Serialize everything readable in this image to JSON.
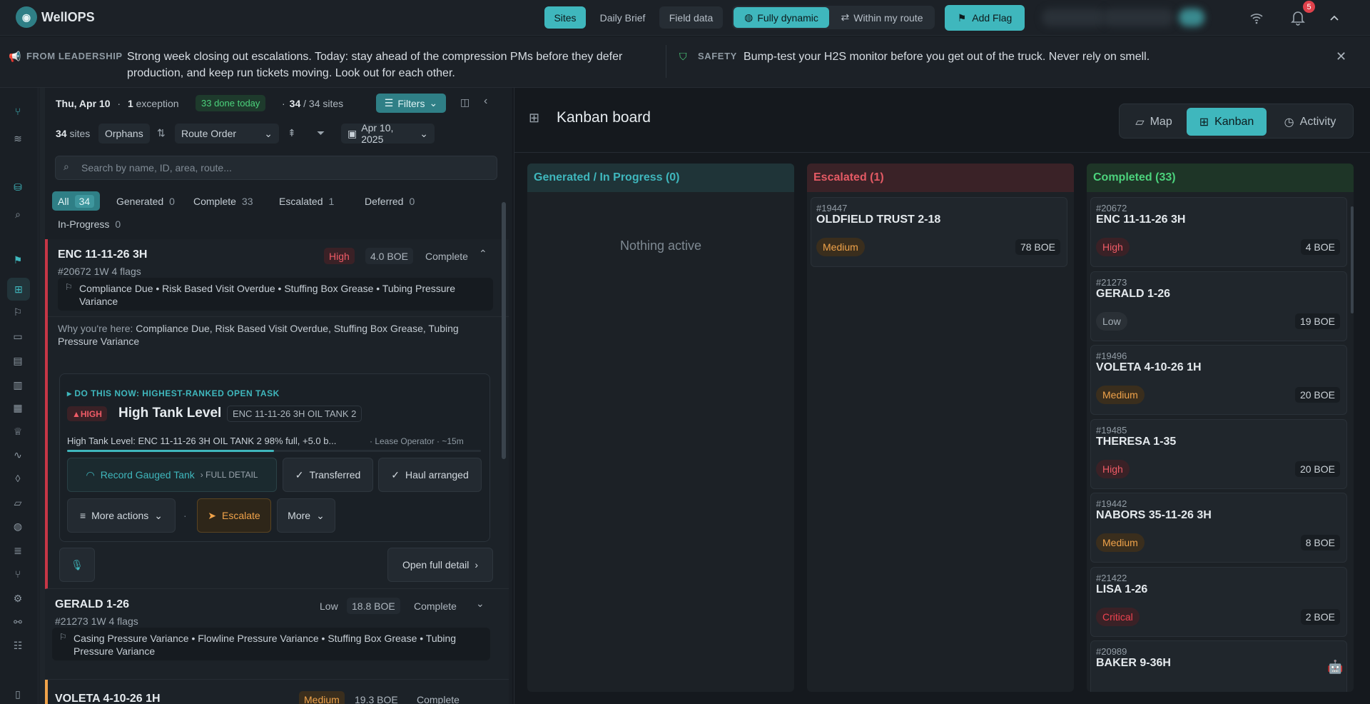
{
  "app": {
    "name": "WellOPS"
  },
  "topbar": {
    "tabs": [
      "Sites",
      "Daily Brief",
      "Field data"
    ],
    "mode": [
      "Fully dynamic",
      "Within my route"
    ],
    "add_flag": "Add Flag",
    "notification_count": "5"
  },
  "banner": {
    "leadership_label": "FROM LEADERSHIP",
    "leadership_text": "Strong week closing out escalations. Today: stay ahead of the compression PMs before they defer production, and keep run tickets moving. Look out for each other.",
    "safety_label": "SAFETY",
    "safety_text": "Bump-test your H2S monitor before you get out of the truck. Never rely on smell."
  },
  "sidebar": {
    "date": "Thu, Apr 10",
    "exceptions_count": "1",
    "exceptions_label": "exception",
    "done_today": "33 done today",
    "sites_shown": "34",
    "sites_total": "/ 34 sites",
    "filters_label": "Filters",
    "site_count": "34",
    "site_count_label": "sites",
    "orphans": "Orphans",
    "sort": "Route Order",
    "date_filter": "Apr 10, 2025",
    "search_placeholder": "Search by name, ID, area, route...",
    "status_tabs": [
      {
        "label": "All",
        "count": "34"
      },
      {
        "label": "Generated",
        "count": "0"
      },
      {
        "label": "Complete",
        "count": "33"
      },
      {
        "label": "Escalated",
        "count": "1"
      },
      {
        "label": "Deferred",
        "count": "0"
      },
      {
        "label": "In-Progress",
        "count": "0"
      }
    ],
    "cards": [
      {
        "name": "ENC 11-11-26 3H",
        "meta": "#20672   1W   4 flags",
        "priority": "High",
        "boe": "4.0 BOE",
        "status": "Complete",
        "flags": "Compliance Due • Risk Based Visit Overdue • Stuffing Box Grease • Tubing Pressure Variance",
        "why_label": "Why you're here:",
        "why_text": "Compliance Due, Risk Based Visit Overdue, Stuffing Box Grease, Tubing Pressure Variance",
        "task_header": "DO THIS NOW: HIGHEST-RANKED OPEN TASK",
        "task_priority": "HIGH",
        "task_title": "High Tank Level",
        "task_asset": "ENC 11-11-26 3H OIL TANK 2",
        "task_desc": "High Tank Level: ENC 11-11-26 3H OIL TANK 2 98% full, +5.0 b...",
        "task_meta": "· Lease Operator · ~15m",
        "task_progress": 0.5,
        "actions": {
          "record": "Record Gauged Tank",
          "full_detail": "FULL DETAIL",
          "transferred": "Transferred",
          "haul": "Haul arranged",
          "more_actions": "More actions",
          "escalate": "Escalate",
          "more": "More",
          "open_detail": "Open full detail"
        }
      },
      {
        "name": "GERALD 1-26",
        "meta": "#21273   1W   4 flags",
        "priority": "Low",
        "boe": "18.8 BOE",
        "status": "Complete",
        "flags": "Casing Pressure Variance • Flowline Pressure Variance • Stuffing Box Grease • Tubing Pressure Variance"
      },
      {
        "name": "VOLETA 4-10-26 1H",
        "priority": "Medium",
        "boe": "19.3 BOE",
        "status": "Complete"
      }
    ]
  },
  "main": {
    "title": "Kanban board",
    "views": [
      "Map",
      "Kanban",
      "Activity"
    ],
    "columns": [
      {
        "title": "Generated / In Progress (0)",
        "empty": "Nothing active"
      },
      {
        "title": "Escalated (1)"
      },
      {
        "title": "Completed (33)"
      }
    ],
    "escalated": [
      {
        "id": "#19447",
        "name": "OLDFIELD TRUST 2-18",
        "priority": "Medium",
        "boe": "78 BOE"
      }
    ],
    "completed": [
      {
        "id": "#20672",
        "name": "ENC 11-11-26 3H",
        "priority": "High",
        "boe": "4 BOE"
      },
      {
        "id": "#21273",
        "name": "GERALD 1-26",
        "priority": "Low",
        "boe": "19 BOE"
      },
      {
        "id": "#19496",
        "name": "VOLETA 4-10-26 1H",
        "priority": "Medium",
        "boe": "20 BOE"
      },
      {
        "id": "#19485",
        "name": "THERESA 1-35",
        "priority": "High",
        "boe": "20 BOE"
      },
      {
        "id": "#19442",
        "name": "NABORS 35-11-26 3H",
        "priority": "Medium",
        "boe": "8 BOE"
      },
      {
        "id": "#21422",
        "name": "LISA 1-26",
        "priority": "Critical",
        "boe": "2 BOE"
      },
      {
        "id": "#20989",
        "name": "BAKER 9-36H",
        "priority": "",
        "boe": ""
      }
    ]
  },
  "colors": {
    "accent": "#3fb7bd",
    "high": "#ef5b66",
    "medium": "#f0a34a",
    "complete": "#4cd27c",
    "escalated": "#e45a64"
  },
  "icons": [
    "logo-icon",
    "megaphone-icon",
    "shield-icon",
    "close-icon",
    "wifi-icon",
    "bell-icon",
    "chevron-up-icon",
    "flag-icon",
    "globe-icon",
    "route-icon",
    "filter-icon",
    "calendar-icon",
    "search-icon",
    "grid-icon",
    "map-icon",
    "clock-icon",
    "mic-icon",
    "bot-icon"
  ]
}
